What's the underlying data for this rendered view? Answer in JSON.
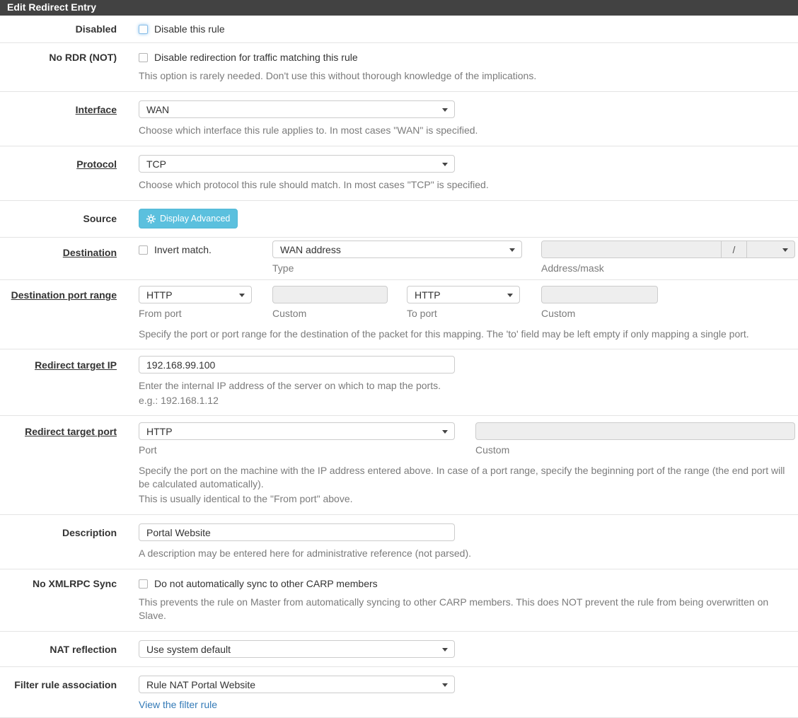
{
  "header": {
    "title": "Edit Redirect Entry"
  },
  "colors": {
    "header_bg": "#424242",
    "info_button": "#5bc0de",
    "link": "#337ab7"
  },
  "icons": {
    "gear": "gear-icon",
    "caret": "chevron-down-icon"
  },
  "fields": {
    "disabled": {
      "label": "Disabled",
      "checkbox_label": "Disable this rule",
      "checked": false
    },
    "nordr": {
      "label": "No RDR (NOT)",
      "checkbox_label": "Disable redirection for traffic matching this rule",
      "checked": false,
      "help": "This option is rarely needed. Don't use this without thorough knowledge of the implications."
    },
    "interface": {
      "label": "Interface",
      "value": "WAN",
      "help": "Choose which interface this rule applies to. In most cases \"WAN\" is specified."
    },
    "protocol": {
      "label": "Protocol",
      "value": "TCP",
      "help": "Choose which protocol this rule should match. In most cases \"TCP\" is specified."
    },
    "source": {
      "label": "Source",
      "button_label": "Display Advanced"
    },
    "destination": {
      "label": "Destination",
      "invert_label": "Invert match.",
      "invert_checked": false,
      "type_value": "WAN address",
      "type_caption": "Type",
      "address_value": "",
      "separator": "/",
      "mask_value": "",
      "address_caption": "Address/mask"
    },
    "dst_port_range": {
      "label": "Destination port range",
      "from_value": "HTTP",
      "from_caption": "From port",
      "from_custom_value": "",
      "from_custom_caption": "Custom",
      "to_value": "HTTP",
      "to_caption": "To port",
      "to_custom_value": "",
      "to_custom_caption": "Custom",
      "help": "Specify the port or port range for the destination of the packet for this mapping. The 'to' field may be left empty if only mapping a single port."
    },
    "redirect_ip": {
      "label": "Redirect target IP",
      "value": "192.168.99.100",
      "help1": "Enter the internal IP address of the server on which to map the ports.",
      "help2": "e.g.: 192.168.1.12"
    },
    "redirect_port": {
      "label": "Redirect target port",
      "value": "HTTP",
      "port_caption": "Port",
      "custom_value": "",
      "custom_caption": "Custom",
      "help1": "Specify the port on the machine with the IP address entered above. In case of a port range, specify the beginning port of the range (the end port will be calculated automatically).",
      "help2": "This is usually identical to the \"From port\" above."
    },
    "description": {
      "label": "Description",
      "value": "Portal Website",
      "help": "A description may be entered here for administrative reference (not parsed)."
    },
    "xmlrpc": {
      "label": "No XMLRPC Sync",
      "checkbox_label": "Do not automatically sync to other CARP members",
      "checked": false,
      "help": "This prevents the rule on Master from automatically syncing to other CARP members. This does NOT prevent the rule from being overwritten on Slave."
    },
    "natreflection": {
      "label": "NAT reflection",
      "value": "Use system default"
    },
    "filter_rule": {
      "label": "Filter rule association",
      "value": "Rule NAT Portal Website",
      "link_label": "View the filter rule"
    }
  }
}
